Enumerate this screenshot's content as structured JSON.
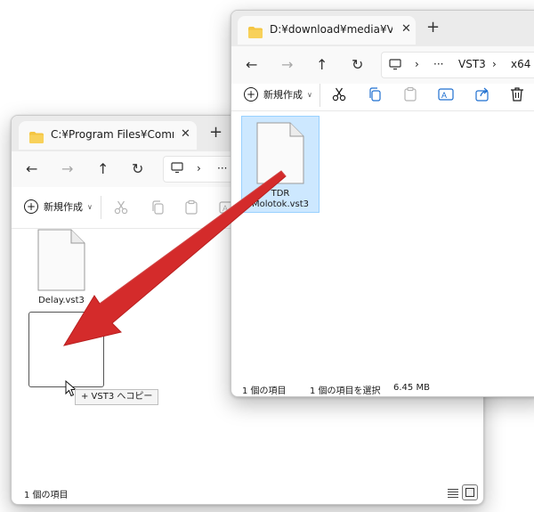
{
  "left_window": {
    "tab_title": "C:¥Program Files¥Common File",
    "toolbar": {
      "new_label": "新規作成"
    },
    "files": [
      {
        "name": "Delay.vst3"
      }
    ],
    "status": {
      "item_count": "1 個の項目"
    },
    "drag_tooltip": "+ VST3 へコピー"
  },
  "right_window": {
    "tab_title": "D:¥download¥media¥VST¥TDR",
    "breadcrumb": [
      "VST3",
      "x64"
    ],
    "toolbar": {
      "new_label": "新規作成"
    },
    "files": [
      {
        "name_line1": "TDR",
        "name_line2": "Molotok.vst3"
      }
    ],
    "status": {
      "item_count": "1 個の項目",
      "selection": "1 個の項目を選択",
      "size": "6.45 MB"
    }
  },
  "colors": {
    "arrow": "#d42b2b",
    "selection_bg": "#cde8ff",
    "folder": "#f4c542"
  }
}
